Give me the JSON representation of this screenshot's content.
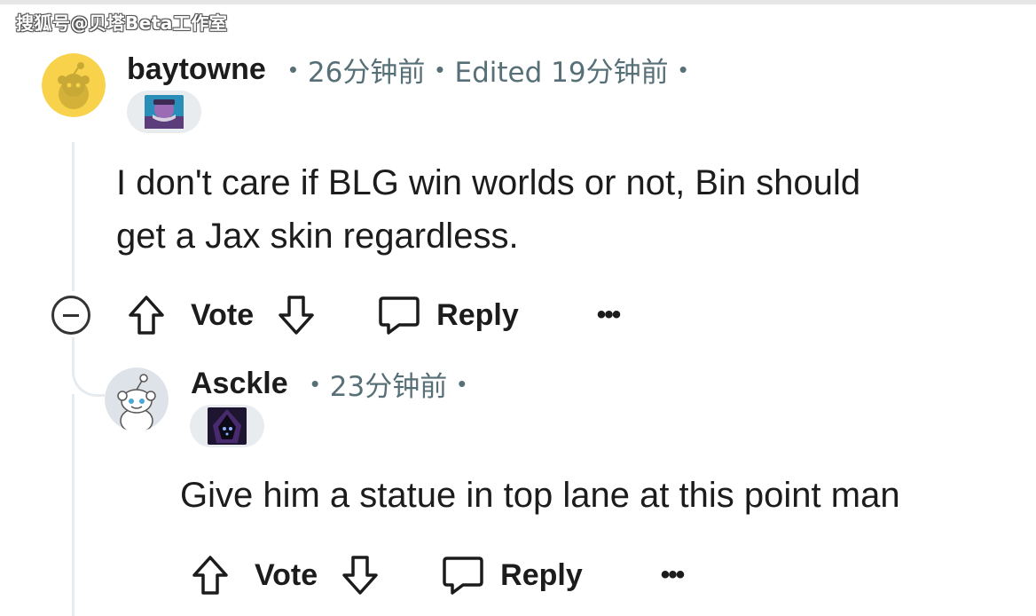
{
  "watermark": "搜狐号@贝塔Beta工作室",
  "comments": [
    {
      "username": "baytowne",
      "time": "26分钟前",
      "edited": "Edited 19分钟前",
      "text_line1": "I don't care if BLG win worlds or not, Bin should",
      "text_line2": "get a Jax skin regardless.",
      "vote_label": "Vote",
      "reply_label": "Reply",
      "more_label": "•••"
    },
    {
      "username": "Asckle",
      "time": "23分钟前",
      "text_line1": "Give him a statue in top lane at this point man",
      "vote_label": "Vote",
      "reply_label": "Reply",
      "more_label": "•••"
    }
  ],
  "colors": {
    "meta_gray": "#576f76",
    "thread_line": "#e5ebee",
    "avatar1_bg": "#f7d24a",
    "avatar2_bg": "#dde3e8"
  },
  "icons": [
    "snoo-avatar-icon",
    "upvote-icon",
    "downvote-icon",
    "comment-icon",
    "collapse-icon",
    "more-icon"
  ]
}
